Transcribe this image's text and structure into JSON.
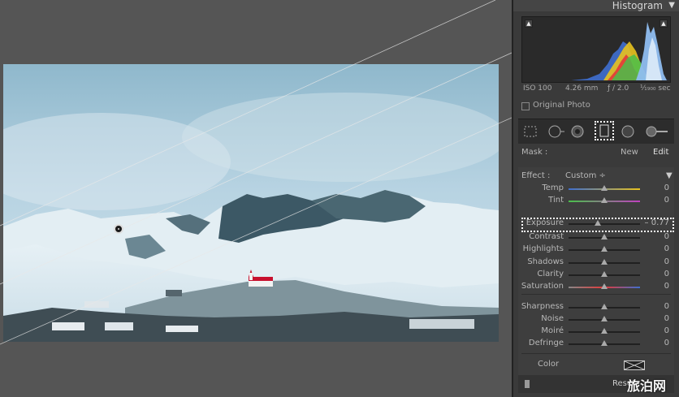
{
  "panel": {
    "title": "Histogram",
    "exif": {
      "iso": "ISO 100",
      "focal": "4.26 mm",
      "aperture": "ƒ / 2.0",
      "shutter": "¹⁄₁₉₀₀ sec"
    },
    "original_photo": "Original Photo",
    "mask": {
      "label": "Mask :",
      "new": "New",
      "edit": "Edit"
    },
    "effect": {
      "label": "Effect :",
      "value": "Custom ÷"
    },
    "sliders": [
      {
        "label": "Temp",
        "value": "0",
        "level": 0.5
      },
      {
        "label": "Tint",
        "value": "0",
        "level": 0.5
      },
      {
        "label": "Exposure",
        "value": "– 0.77",
        "level": 0.41
      },
      {
        "label": "Contrast",
        "value": "0",
        "level": 0.5
      },
      {
        "label": "Highlights",
        "value": "0",
        "level": 0.5
      },
      {
        "label": "Shadows",
        "value": "0",
        "level": 0.5
      },
      {
        "label": "Clarity",
        "value": "0",
        "level": 0.5
      },
      {
        "label": "Saturation",
        "value": "0",
        "level": 0.5
      },
      {
        "label": "Sharpness",
        "value": "0",
        "level": 0.5
      },
      {
        "label": "Noise",
        "value": "0",
        "level": 0.5
      },
      {
        "label": "Moiré",
        "value": "0",
        "level": 0.5
      },
      {
        "label": "Defringe",
        "value": "0",
        "level": 0.5
      }
    ],
    "color_label": "Color",
    "reset": "Reset"
  },
  "tools": [
    "crop-overlay-icon",
    "spot-removal-icon",
    "red-eye-icon",
    "graduated-filter-icon",
    "radial-filter-icon",
    "adjustment-brush-icon"
  ],
  "watermark": "旅泊网",
  "colors": {
    "panel_bg": "#3a3a3a",
    "highlight_border": "#ffffff",
    "sky": "#9fc3d6",
    "church_roof": "#c8102e"
  }
}
